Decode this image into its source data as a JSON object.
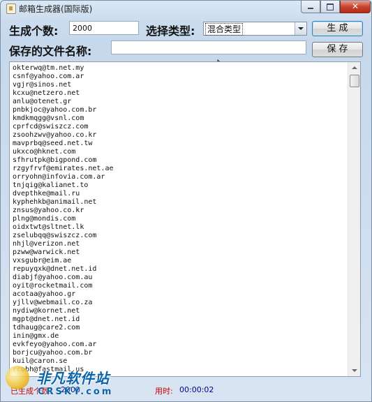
{
  "window": {
    "title": "邮箱生成器(国际版)"
  },
  "form": {
    "count_label": "生成个数:",
    "count_value": "2000",
    "type_label": "选择类型:",
    "type_selected": "混合类型",
    "generate_button": "生 成",
    "filename_label": "保存的文件名称:",
    "filename_value": "",
    "save_button": "保 存"
  },
  "emails": [
    "okterwq@tm.net.my",
    "csnf@yahoo.com.ar",
    "vgjr@sinos.net",
    "kcxu@netzero.net",
    "anlu@otenet.gr",
    "pnbkjoc@yahoo.com.br",
    "kmdkmqgg@vsnl.com",
    "cprfcd@swiszcz.com",
    "zsoohzwv@yahoo.co.kr",
    "mavprbq@seed.net.tw",
    "ukxco@hknet.com",
    "sfhrutpk@bigpond.com",
    "rzgyfrvf@emirates.net.ae",
    "orryohn@infovia.com.ar",
    "tnjqig@kalianet.to",
    "dvepthke@mail.ru",
    "kyphehkb@animail.net",
    "znsus@yahoo.co.kr",
    "plng@mondis.com",
    "oidxtwt@sltnet.lk",
    "zselubqq@swiszcz.com",
    "nhjl@verizon.net",
    "pzww@warwick.net",
    "vxsgubr@eim.ae",
    "repuyqxk@dnet.net.id",
    "diabjf@yahoo.com.au",
    "oyit@rocketmail.com",
    "acotaa@yahoo.gr",
    "yjllv@webmail.co.za",
    "nydiw@kornet.net",
    "mgpt@dnet.net.id",
    "tdhaug@care2.com",
    "inin@gmx.de",
    "evkfeyo@yahoo.com.ar",
    "borjcu@yahoo.com.br",
    "kuil@caron.se",
    "rcobh@fastmail.us"
  ],
  "status": {
    "generated_label": "已生成个数:",
    "generated_value": "2000",
    "time_label": "用时:",
    "time_value": "00:00:02"
  },
  "watermark": {
    "cn": "非凡软件站",
    "en": "CRSKY.com"
  },
  "colors": {
    "status_label": "#cc0000",
    "status_value": "#00008b",
    "watermark": "#0b64a8"
  }
}
